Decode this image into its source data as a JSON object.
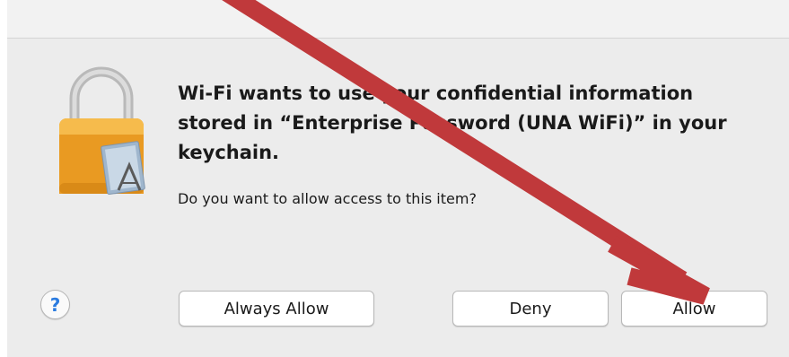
{
  "dialog": {
    "heading": "Wi-Fi wants to use your confidential information stored in “Enterprise Password (UNA WiFi)” in your keychain.",
    "question": "Do you want to allow access to this item?",
    "help_label": "?",
    "buttons": {
      "always_allow": "Always Allow",
      "deny": "Deny",
      "allow": "Allow"
    }
  },
  "annotation": {
    "arrow_color": "#c0393b",
    "points_to": "allow-button"
  },
  "icon": {
    "name": "keychain-lock-icon",
    "lock_color": "#f0a830"
  }
}
